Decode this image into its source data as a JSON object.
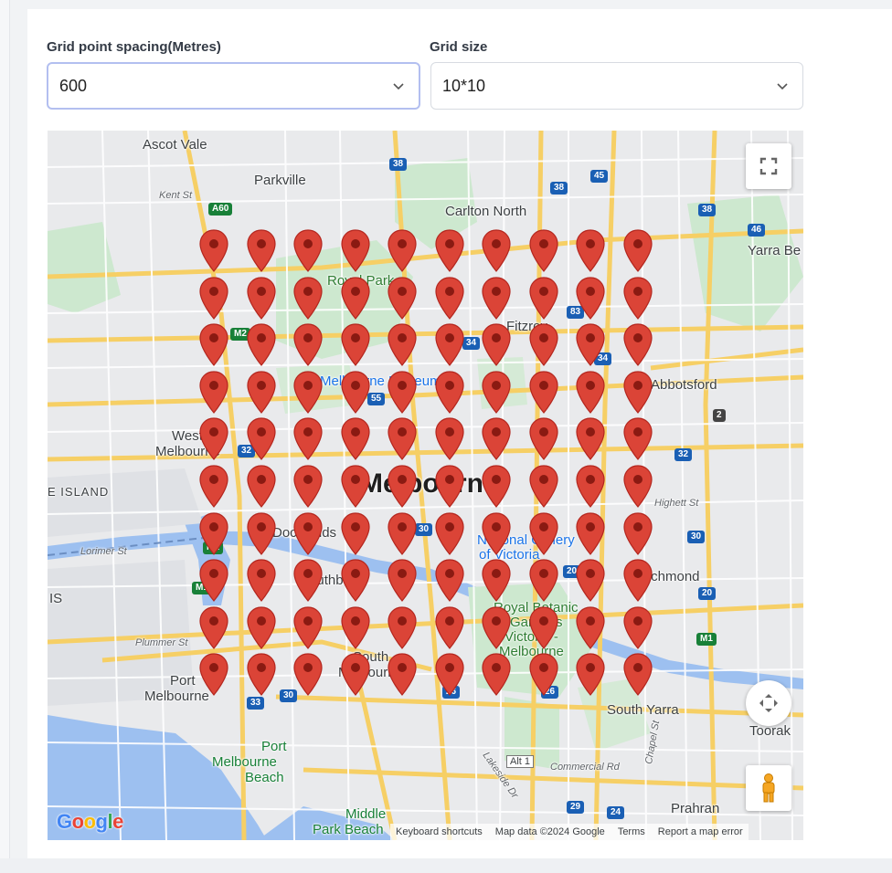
{
  "form": {
    "spacing_label": "Grid point spacing(Metres)",
    "spacing_value": "600",
    "size_label": "Grid size",
    "size_value": "10*10"
  },
  "map": {
    "labels": {
      "ascot_vale": "Ascot Vale",
      "parkville": "Parkville",
      "kent_st": "Kent St",
      "carlton_north": "Carlton North",
      "yarra_bend": "Yarra Be",
      "royal_park": "Royal Park",
      "fitzroy": "Fitzroy",
      "abbotsford": "Abbotsford",
      "melbourne_museum": "Melbourne Museum",
      "west_melbourne_1": "West",
      "west_melbourne_2": "Melbourne",
      "melbourne": "Melbourne",
      "island": "E ISLAND",
      "highett_st": "Highett St",
      "docklands": "Docklands",
      "national_gallery_1": "National Gallery",
      "national_gallery_2": "of Victoria",
      "lorimer_st": "Lorimer St",
      "richmond": "Richmond",
      "is": "IS",
      "southbank": "Southbank",
      "royal_botanic_1": "Royal Botanic",
      "royal_botanic_2": "Gardens",
      "royal_botanic_3": "Victoria -",
      "royal_botanic_4": "Melbourne",
      "plummer_st": "Plummer St",
      "port_melbourne_1": "Port",
      "port_melbourne_2": "Melbourne",
      "south_melbourne_1": "South",
      "south_melbourne_2": "Melbourne",
      "south_yarra": "South Yarra",
      "toorak": "Toorak",
      "port_melbourne_beach_1": "Port",
      "port_melbourne_beach_2": "Melbourne",
      "port_melbourne_beach_3": "Beach",
      "commercial_rd": "Commercial Rd",
      "lakeside_dr": "Lakeside Dr",
      "chapel_st": "Chapel St",
      "prahran": "Prahran",
      "middle_park_1": "Middle",
      "middle_park_2": "Park Beach",
      "alt1": "Alt 1"
    },
    "route_shields": [
      "38",
      "45",
      "38",
      "46",
      "A60",
      "38",
      "M2",
      "34",
      "83",
      "34",
      "55",
      "32",
      "32",
      "30",
      "M1",
      "20",
      "30",
      "M1",
      "20",
      "M1",
      "30",
      "33",
      "26",
      "26",
      "29",
      "24",
      "2"
    ],
    "grid": {
      "rows": 10,
      "cols": 10
    },
    "marker_color": "#db4437",
    "google_logo": "Google",
    "attribution": {
      "keyboard": "Keyboard shortcuts",
      "data": "Map data ©2024 Google",
      "terms": "Terms",
      "report": "Report a map error"
    }
  }
}
